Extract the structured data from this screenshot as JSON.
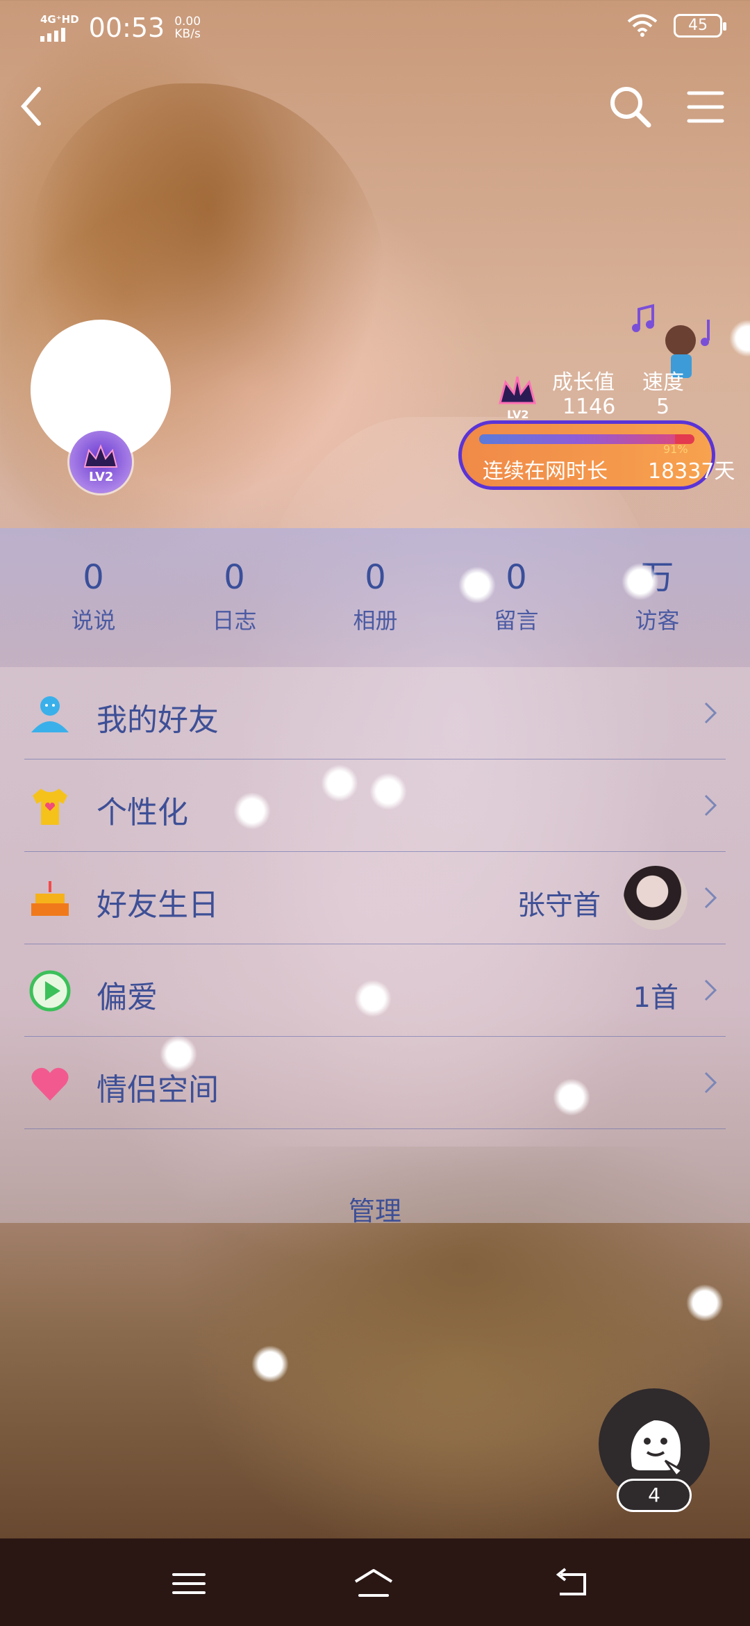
{
  "status_bar": {
    "network": "4G⁺HD",
    "time": "00:53",
    "net_speed_value": "0.00",
    "net_speed_unit": "KB/s",
    "battery": "45"
  },
  "profile": {
    "level_badge": "LV2"
  },
  "growth": {
    "growth_label": "成长值",
    "growth_value": "1146",
    "speed_label": "速度",
    "speed_value": "5",
    "progress_percent": "91%",
    "progress_fraction": 0.91,
    "online_label": "连续在网时长",
    "online_value": "18337天"
  },
  "stats": [
    {
      "num": "0",
      "label": "说说"
    },
    {
      "num": "0",
      "label": "日志"
    },
    {
      "num": "0",
      "label": "相册"
    },
    {
      "num": "0",
      "label": "留言"
    },
    {
      "num": "万",
      "label": "访客"
    }
  ],
  "menu": [
    {
      "label": "我的好友",
      "right": "",
      "icon": "friends-icon"
    },
    {
      "label": "个性化",
      "right": "",
      "icon": "tshirt-icon"
    },
    {
      "label": "好友生日",
      "right": "张守首",
      "icon": "cake-icon"
    },
    {
      "label": "偏爱",
      "right": "1首",
      "icon": "play-icon"
    },
    {
      "label": "情侣空间",
      "right": "",
      "icon": "heart-icon"
    }
  ],
  "manage_label": "管理",
  "float_button": {
    "count": "4"
  },
  "colors": {
    "accent_text": "#3d4f96",
    "panel_tint": "#afafde",
    "online_pill": "#f08a48",
    "pill_border": "#5a34d6"
  }
}
